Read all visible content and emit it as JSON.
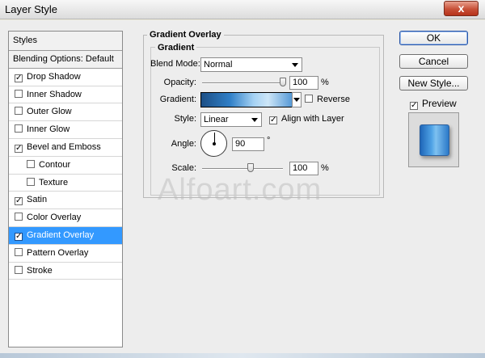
{
  "window": {
    "title": "Layer Style",
    "close_glyph": "x"
  },
  "styles_panel": {
    "header": "Styles",
    "blending": "Blending Options: Default",
    "items": [
      {
        "label": "Drop Shadow",
        "checked": true,
        "sub": false
      },
      {
        "label": "Inner Shadow",
        "checked": false,
        "sub": false
      },
      {
        "label": "Outer Glow",
        "checked": false,
        "sub": false
      },
      {
        "label": "Inner Glow",
        "checked": false,
        "sub": false
      },
      {
        "label": "Bevel and Emboss",
        "checked": true,
        "sub": false
      },
      {
        "label": "Contour",
        "checked": false,
        "sub": true
      },
      {
        "label": "Texture",
        "checked": false,
        "sub": true
      },
      {
        "label": "Satin",
        "checked": true,
        "sub": false
      },
      {
        "label": "Color Overlay",
        "checked": false,
        "sub": false
      },
      {
        "label": "Gradient Overlay",
        "checked": true,
        "sub": false,
        "selected": true
      },
      {
        "label": "Pattern Overlay",
        "checked": false,
        "sub": false
      },
      {
        "label": "Stroke",
        "checked": false,
        "sub": false
      }
    ]
  },
  "gradient_overlay": {
    "group_title": "Gradient Overlay",
    "inner_title": "Gradient",
    "blend_mode_label": "Blend Mode:",
    "blend_mode_value": "Normal",
    "opacity_label": "Opacity:",
    "opacity_value": "100",
    "opacity_unit": "%",
    "opacity_level": 1.0,
    "gradient_label": "Gradient:",
    "reverse_label": "Reverse",
    "reverse_checked": false,
    "style_label": "Style:",
    "style_value": "Linear",
    "align_label": "Align with Layer",
    "align_checked": true,
    "angle_label": "Angle:",
    "angle_value": "90",
    "angle_unit": "°",
    "scale_label": "Scale:",
    "scale_value": "100",
    "scale_unit": "%",
    "scale_level": 0.6
  },
  "buttons": {
    "ok": "OK",
    "cancel": "Cancel",
    "new_style": "New Style..."
  },
  "preview": {
    "label": "Preview",
    "checked": true
  },
  "watermark": "Alfoart.com",
  "colors": {
    "selection": "#3399ff",
    "gradient_dark": "#1d4f86",
    "gradient_light": "#cde6f8"
  }
}
